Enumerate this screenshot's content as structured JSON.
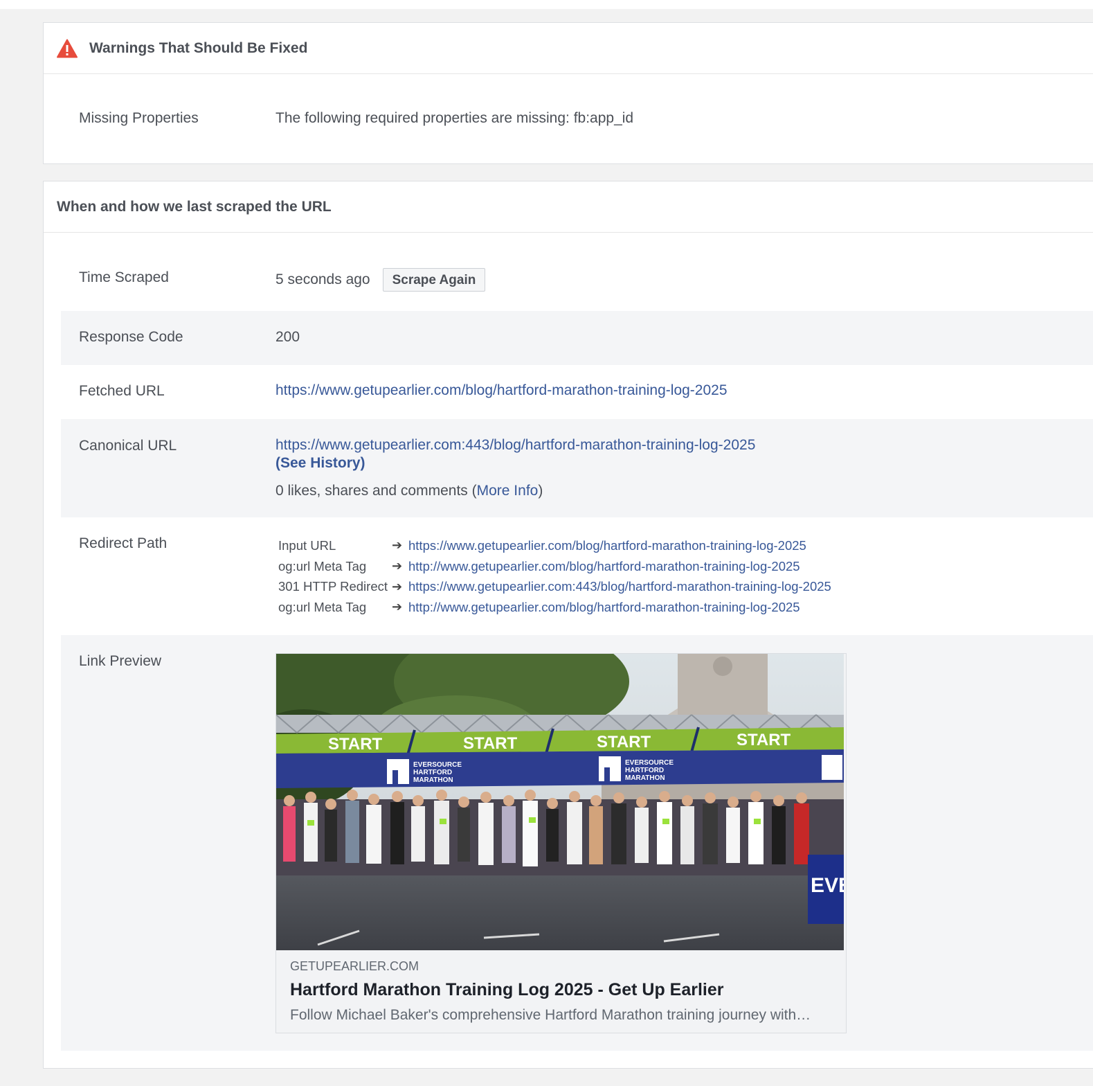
{
  "warnings": {
    "title": "Warnings That Should Be Fixed",
    "rows": [
      {
        "label": "Missing Properties",
        "value": "The following required properties are missing: fb:app_id"
      }
    ]
  },
  "scrape": {
    "title": "When and how we last scraped the URL",
    "time_scraped": {
      "label": "Time Scraped",
      "value": "5 seconds ago",
      "button": "Scrape Again"
    },
    "response_code": {
      "label": "Response Code",
      "value": "200"
    },
    "fetched_url": {
      "label": "Fetched URL",
      "value": "https://www.getupearlier.com/blog/hartford-marathon-training-log-2025"
    },
    "canonical_url": {
      "label": "Canonical URL",
      "value": "https://www.getupearlier.com:443/blog/hartford-marathon-training-log-2025",
      "history_link": "(See History)",
      "engagement_prefix": "0 likes, shares and comments (",
      "more_info": "More Info",
      "engagement_suffix": ")"
    },
    "redirect_path": {
      "label": "Redirect Path",
      "steps": [
        {
          "type": "Input URL",
          "url": "https://www.getupearlier.com/blog/hartford-marathon-training-log-2025"
        },
        {
          "type": "og:url Meta Tag",
          "url": "http://www.getupearlier.com/blog/hartford-marathon-training-log-2025"
        },
        {
          "type": "301 HTTP Redirect",
          "url": "https://www.getupearlier.com:443/blog/hartford-marathon-training-log-2025"
        },
        {
          "type": "og:url Meta Tag",
          "url": "http://www.getupearlier.com/blog/hartford-marathon-training-log-2025"
        }
      ]
    },
    "link_preview": {
      "label": "Link Preview",
      "domain": "GETUPEARLIER.COM",
      "title": "Hartford Marathon Training Log 2025 - Get Up Earlier",
      "description": "Follow Michael Baker's comprehensive Hartford Marathon training journey with…",
      "image_text": {
        "banner": "START",
        "sponsor_line1": "EVERSOURCE",
        "sponsor_line2": "HARTFORD",
        "sponsor_line3": "MARATHON",
        "side_sign": "EVE"
      }
    }
  },
  "colors": {
    "link": "#385898",
    "warning": "#e74c3c",
    "shaded_row": "#f4f5f7"
  },
  "icons": {
    "warning": "warning-triangle-icon",
    "arrow": "right-arrow-icon"
  }
}
